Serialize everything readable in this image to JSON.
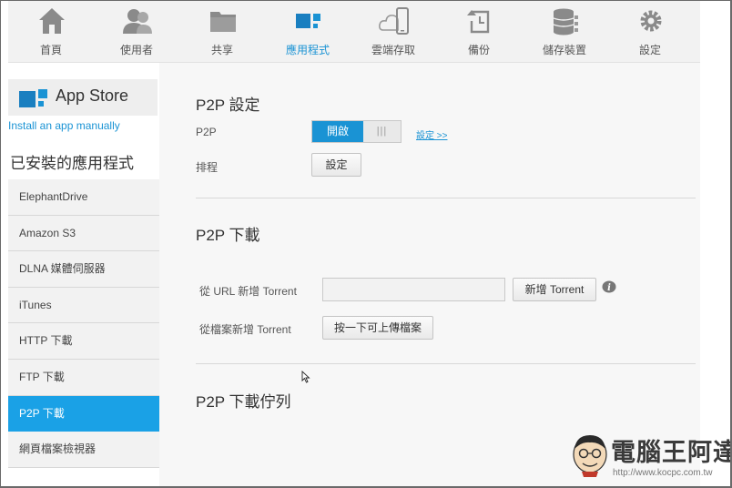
{
  "nav": {
    "items": [
      {
        "label": "首頁",
        "icon": "home-icon"
      },
      {
        "label": "使用者",
        "icon": "users-icon"
      },
      {
        "label": "共享",
        "icon": "folder-icon"
      },
      {
        "label": "應用程式",
        "icon": "apps-icon"
      },
      {
        "label": "雲端存取",
        "icon": "cloud-device-icon"
      },
      {
        "label": "備份",
        "icon": "backup-icon"
      },
      {
        "label": "儲存裝置",
        "icon": "storage-icon"
      },
      {
        "label": "設定",
        "icon": "gear-icon"
      }
    ],
    "active_index": 3,
    "active_color": "#1a93d4"
  },
  "sidebar": {
    "app_store_label": "App Store",
    "install_link": "Install an app manually",
    "installed_title": "已安裝的應用程式",
    "apps": [
      "ElephantDrive",
      "Amazon S3",
      "DLNA 媒體伺服器",
      "iTunes",
      "HTTP 下載",
      "FTP 下載",
      "P2P 下載",
      "網頁檔案檢視器"
    ],
    "active_index": 6,
    "active_color": "#1aa1e6"
  },
  "main": {
    "p2p_settings": {
      "title": "P2P 設定",
      "p2p_label": "P2P",
      "toggle_on_label": "開啟",
      "toggle_grip": "|||",
      "settings_link": "設定 >>",
      "schedule_label": "排程",
      "schedule_button": "設定"
    },
    "p2p_download": {
      "title": "P2P 下載",
      "url_label": "從 URL 新增 Torrent",
      "url_value": "",
      "add_torrent_button": "新增 Torrent",
      "file_label": "從檔案新增 Torrent",
      "upload_button": "按一下可上傳檔案"
    },
    "p2p_queue": {
      "title": "P2P 下載佇列"
    }
  },
  "watermark": {
    "title": "電腦王阿達",
    "url": "http://www.kocpc.com.tw"
  }
}
